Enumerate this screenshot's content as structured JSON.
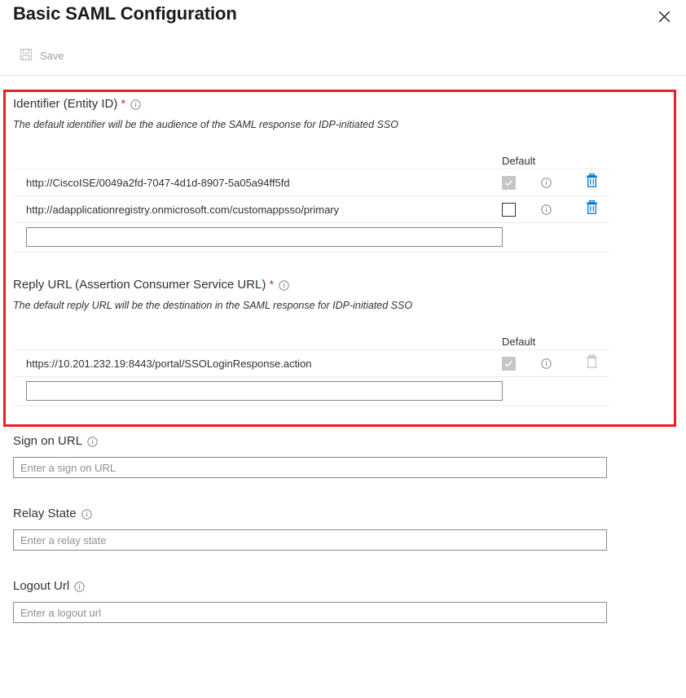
{
  "header": {
    "title": "Basic SAML Configuration",
    "close_icon": "close-icon"
  },
  "command_bar": {
    "save_label": "Save",
    "save_icon": "save-floppy-icon",
    "save_disabled": true
  },
  "annotation": {
    "color": "#ec1c24"
  },
  "identifier_section": {
    "label": "Identifier (Entity ID)",
    "required_marker": "*",
    "info_icon": "info-icon",
    "description": "The default identifier will be the audience of the SAML response for IDP-initiated SSO",
    "columns": {
      "default": "Default"
    },
    "rows": [
      {
        "value": "http://CiscoISE/0049a2fd-7047-4d1d-8907-5a05a94ff5fd",
        "default_checked": true,
        "default_disabled": true,
        "info_icon": "info-icon",
        "delete_icon": "trash-icon",
        "delete_color": "#0078d4",
        "delete_enabled": true
      },
      {
        "value": "http://adapplicationregistry.onmicrosoft.com/customappsso/primary",
        "default_checked": false,
        "default_disabled": false,
        "info_icon": "info-icon",
        "delete_icon": "trash-icon",
        "delete_color": "#0078d4",
        "delete_enabled": true
      }
    ],
    "new_entry_value": "",
    "new_entry_placeholder": ""
  },
  "reply_url_section": {
    "label": "Reply URL (Assertion Consumer Service URL)",
    "required_marker": "*",
    "info_icon": "info-icon",
    "description": "The default reply URL will be the destination in the SAML response for IDP-initiated SSO",
    "columns": {
      "default": "Default"
    },
    "rows": [
      {
        "value": "https://10.201.232.19:8443/portal/SSOLoginResponse.action",
        "default_checked": true,
        "default_disabled": true,
        "info_icon": "info-icon",
        "delete_icon": "trash-icon",
        "delete_color": "#c8c6c4",
        "delete_enabled": false
      }
    ],
    "new_entry_value": "",
    "new_entry_placeholder": ""
  },
  "sign_on_url": {
    "label": "Sign on URL",
    "info_icon": "info-icon",
    "value": "",
    "placeholder": "Enter a sign on URL"
  },
  "relay_state": {
    "label": "Relay State",
    "info_icon": "info-icon",
    "value": "",
    "placeholder": "Enter a relay state"
  },
  "logout_url": {
    "label": "Logout Url",
    "info_icon": "info-icon",
    "value": "",
    "placeholder": "Enter a logout url"
  }
}
